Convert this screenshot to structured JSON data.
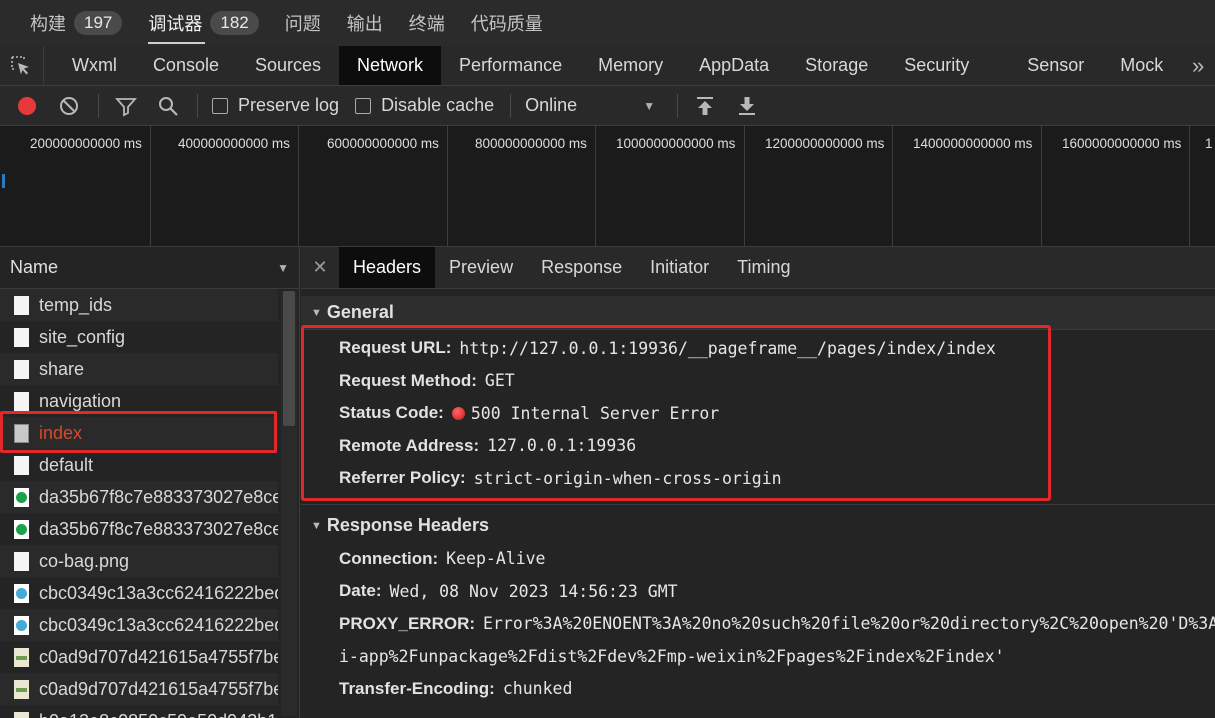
{
  "top_tabs": [
    {
      "label": "构建",
      "count": "197"
    },
    {
      "label": "调试器",
      "count": "182"
    },
    {
      "label": "问题"
    },
    {
      "label": "输出"
    },
    {
      "label": "终端"
    },
    {
      "label": "代码质量"
    }
  ],
  "dev_tabs": [
    "Wxml",
    "Console",
    "Sources",
    "Network",
    "Performance",
    "Memory",
    "AppData",
    "Storage",
    "Security",
    "Sensor",
    "Mock"
  ],
  "toolbar": {
    "preserve_log": "Preserve log",
    "disable_cache": "Disable cache",
    "throttle": "Online"
  },
  "timeline": {
    "labels": [
      "200000000000 ms",
      "400000000000 ms",
      "600000000000 ms",
      "800000000000 ms",
      "1000000000000 ms",
      "1200000000000 ms",
      "1400000000000 ms",
      "1600000000000 ms",
      "1"
    ]
  },
  "request_list": {
    "header": "Name",
    "rows": [
      {
        "name": "temp_ids",
        "icon": "doc-icon"
      },
      {
        "name": "site_config",
        "icon": "doc-icon"
      },
      {
        "name": "share",
        "icon": "doc-icon"
      },
      {
        "name": "navigation",
        "icon": "doc-icon"
      },
      {
        "name": "index",
        "icon": "image-doc-icon"
      },
      {
        "name": "default",
        "icon": "doc-icon"
      },
      {
        "name": "da35b67f8c7e883373027e8ce.",
        "icon": "green-image-icon"
      },
      {
        "name": "da35b67f8c7e883373027e8ce.",
        "icon": "green-image-icon"
      },
      {
        "name": "co-bag.png",
        "icon": "doc-icon"
      },
      {
        "name": "cbc0349c13a3cc62416222bed.",
        "icon": "blue-image-icon"
      },
      {
        "name": "cbc0349c13a3cc62416222bed.",
        "icon": "blue-image-icon"
      },
      {
        "name": "c0ad9d707d421615a4755f7be",
        "icon": "picture-icon"
      },
      {
        "name": "c0ad9d707d421615a4755f7be",
        "icon": "picture-icon"
      },
      {
        "name": "b0a12e8c0850c59e50d943b1",
        "icon": "picture-icon"
      }
    ]
  },
  "detail": {
    "tabs": [
      "Headers",
      "Preview",
      "Response",
      "Initiator",
      "Timing"
    ],
    "general": {
      "title": "General",
      "request_url_key": "Request URL:",
      "request_url": "http://127.0.0.1:19936/__pageframe__/pages/index/index",
      "request_method_key": "Request Method:",
      "request_method": "GET",
      "status_code_key": "Status Code:",
      "status_code": "500 Internal Server Error",
      "status_color": "#e0262b",
      "remote_address_key": "Remote Address:",
      "remote_address": "127.0.0.1:19936",
      "referrer_policy_key": "Referrer Policy:",
      "referrer_policy": "strict-origin-when-cross-origin"
    },
    "response_headers": {
      "title": "Response Headers",
      "connection_key": "Connection:",
      "connection": "Keep-Alive",
      "date_key": "Date:",
      "date": "Wed, 08 Nov 2023 14:56:23 GMT",
      "proxy_error_key": "PROXY_ERROR:",
      "proxy_error": "Error%3A%20ENOENT%3A%20no%20such%20file%20or%20directory%2C%20open%20'D%3A%",
      "proxy_error_cont": "i-app%2Funpackage%2Fdist%2Fdev%2Fmp-weixin%2Fpages%2Findex%2Findex'",
      "transfer_encoding_key": "Transfer-Encoding:",
      "transfer_encoding": "chunked"
    }
  },
  "highlight_color": "#e3282b"
}
